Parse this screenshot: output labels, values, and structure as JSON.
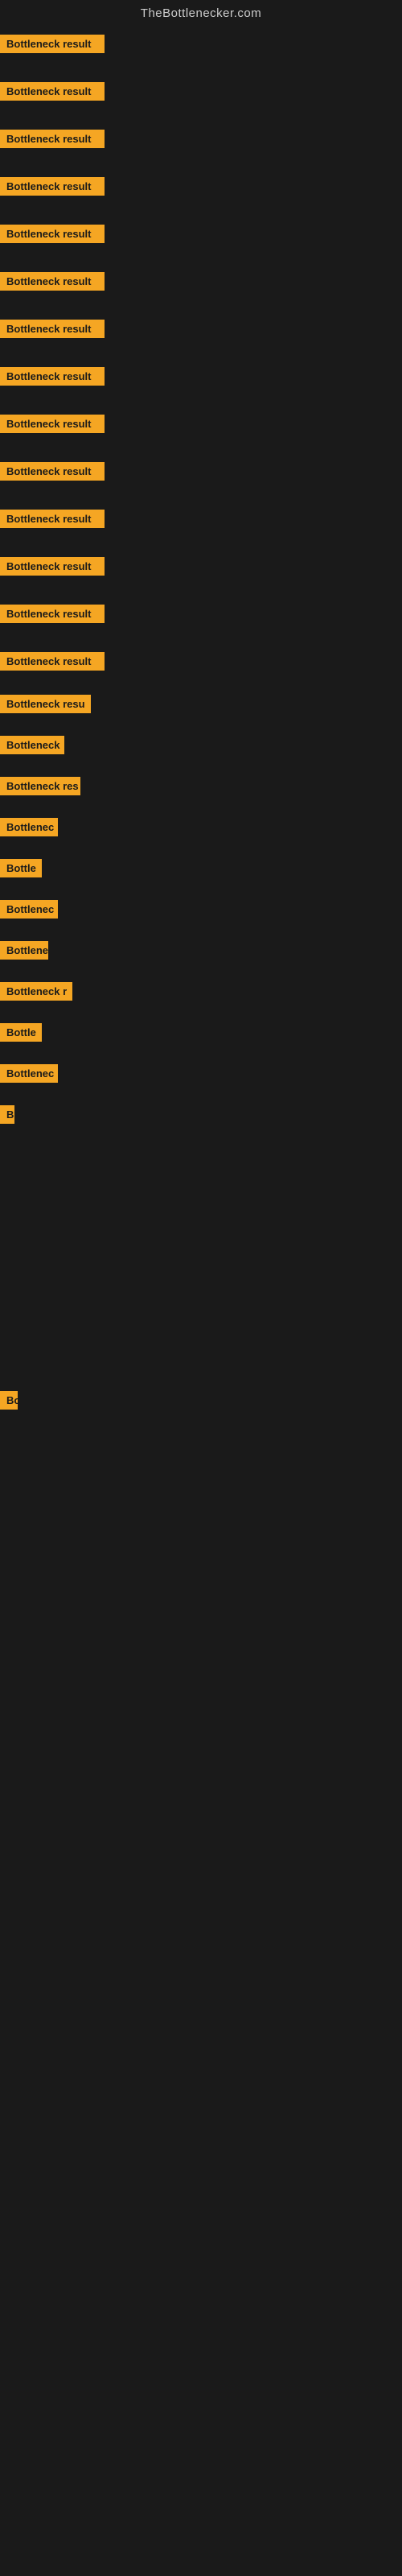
{
  "header": {
    "title": "TheBottlenecker.com"
  },
  "colors": {
    "badge_bg": "#f5a623",
    "badge_text": "#1a1a1a",
    "page_bg": "#1a1a1a"
  },
  "items": [
    {
      "id": 0,
      "label": "Bottleneck result",
      "width": 130
    },
    {
      "id": 1,
      "label": "Bottleneck result",
      "width": 130
    },
    {
      "id": 2,
      "label": "Bottleneck result",
      "width": 130
    },
    {
      "id": 3,
      "label": "Bottleneck result",
      "width": 130
    },
    {
      "id": 4,
      "label": "Bottleneck result",
      "width": 130
    },
    {
      "id": 5,
      "label": "Bottleneck result",
      "width": 130
    },
    {
      "id": 6,
      "label": "Bottleneck result",
      "width": 130
    },
    {
      "id": 7,
      "label": "Bottleneck result",
      "width": 130
    },
    {
      "id": 8,
      "label": "Bottleneck result",
      "width": 130
    },
    {
      "id": 9,
      "label": "Bottleneck result",
      "width": 130
    },
    {
      "id": 10,
      "label": "Bottleneck result",
      "width": 130
    },
    {
      "id": 11,
      "label": "Bottleneck result",
      "width": 130
    },
    {
      "id": 12,
      "label": "Bottleneck result",
      "width": 130
    },
    {
      "id": 13,
      "label": "Bottleneck result",
      "width": 130
    },
    {
      "id": 14,
      "label": "Bottleneck resu",
      "width": 113
    },
    {
      "id": 15,
      "label": "Bottleneck",
      "width": 80
    },
    {
      "id": 16,
      "label": "Bottleneck res",
      "width": 100
    },
    {
      "id": 17,
      "label": "Bottlenec",
      "width": 72
    },
    {
      "id": 18,
      "label": "Bottle",
      "width": 52
    },
    {
      "id": 19,
      "label": "Bottlenec",
      "width": 72
    },
    {
      "id": 20,
      "label": "Bottlene",
      "width": 65
    },
    {
      "id": 21,
      "label": "Bottleneck r",
      "width": 90
    },
    {
      "id": 22,
      "label": "Bottle",
      "width": 52
    },
    {
      "id": 23,
      "label": "Bottlenec",
      "width": 72
    },
    {
      "id": 24,
      "label": "B",
      "width": 18
    }
  ],
  "late_item": {
    "label": "Bo",
    "width": 22
  }
}
